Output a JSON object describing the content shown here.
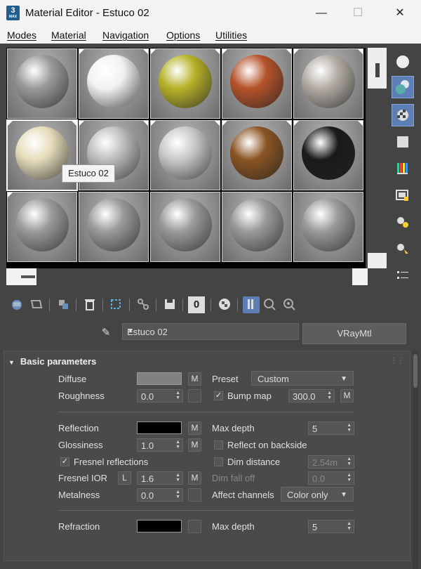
{
  "window": {
    "title": "Material Editor - Estuco 02",
    "icon_text": "3",
    "icon_sub": "MAX",
    "minimize": "—",
    "maximize": "☐",
    "close": "✕"
  },
  "menu": [
    "Modes",
    "Material",
    "Navigation",
    "Options",
    "Utilities"
  ],
  "slots": [
    {
      "name": "slot-1",
      "color": "#9a9a9a"
    },
    {
      "name": "slot-2",
      "color": "#f2f2f2"
    },
    {
      "name": "slot-3",
      "color": "#b7b22a"
    },
    {
      "name": "slot-4",
      "color": "#b5532a"
    },
    {
      "name": "slot-5",
      "color": "#b2aca4"
    },
    {
      "name": "slot-6",
      "color": "#e6dcbb"
    },
    {
      "name": "slot-7",
      "color": "#bdbdbd"
    },
    {
      "name": "slot-8",
      "color": "#c8c8c8"
    },
    {
      "name": "slot-9",
      "color": "#8a5423"
    },
    {
      "name": "slot-10",
      "color": "#1a1a1a"
    },
    {
      "name": "slot-11",
      "color": "#9a9a9a"
    },
    {
      "name": "slot-12",
      "color": "#9a9a9a"
    },
    {
      "name": "slot-13",
      "color": "#9a9a9a"
    },
    {
      "name": "slot-14",
      "color": "#9a9a9a"
    },
    {
      "name": "slot-15",
      "color": "#9a9a9a"
    }
  ],
  "tooltip": "Estuco 02",
  "material": {
    "name": "Estuco 02",
    "type": "VRayMtl"
  },
  "toolbar": {
    "id_value": "0"
  },
  "basic": {
    "header": "Basic parameters",
    "diffuse_label": "Diffuse",
    "diffuse_color": "#808080",
    "roughness_label": "Roughness",
    "roughness_value": "0.0",
    "preset_label": "Preset",
    "preset_value": "Custom",
    "bump_label": "Bump map",
    "bump_value": "300.0",
    "reflection_label": "Reflection",
    "reflection_color": "#000000",
    "maxdepth_label": "Max depth",
    "maxdepth_value": "5",
    "glossiness_label": "Glossiness",
    "glossiness_value": "1.0",
    "backside_label": "Reflect on backside",
    "fresnel_label": "Fresnel reflections",
    "dim_label": "Dim distance",
    "dim_value": "2.54m",
    "ior_label": "Fresnel IOR",
    "ior_lock": "L",
    "ior_value": "1.6",
    "falloff_label": "Dim fall off",
    "falloff_value": "0.0",
    "metalness_label": "Metalness",
    "metalness_value": "0.0",
    "affect_label": "Affect channels",
    "affect_value": "Color only",
    "refraction_label": "Refraction",
    "maxdepth2_label": "Max depth",
    "maxdepth2_value": "5",
    "m": "M"
  }
}
